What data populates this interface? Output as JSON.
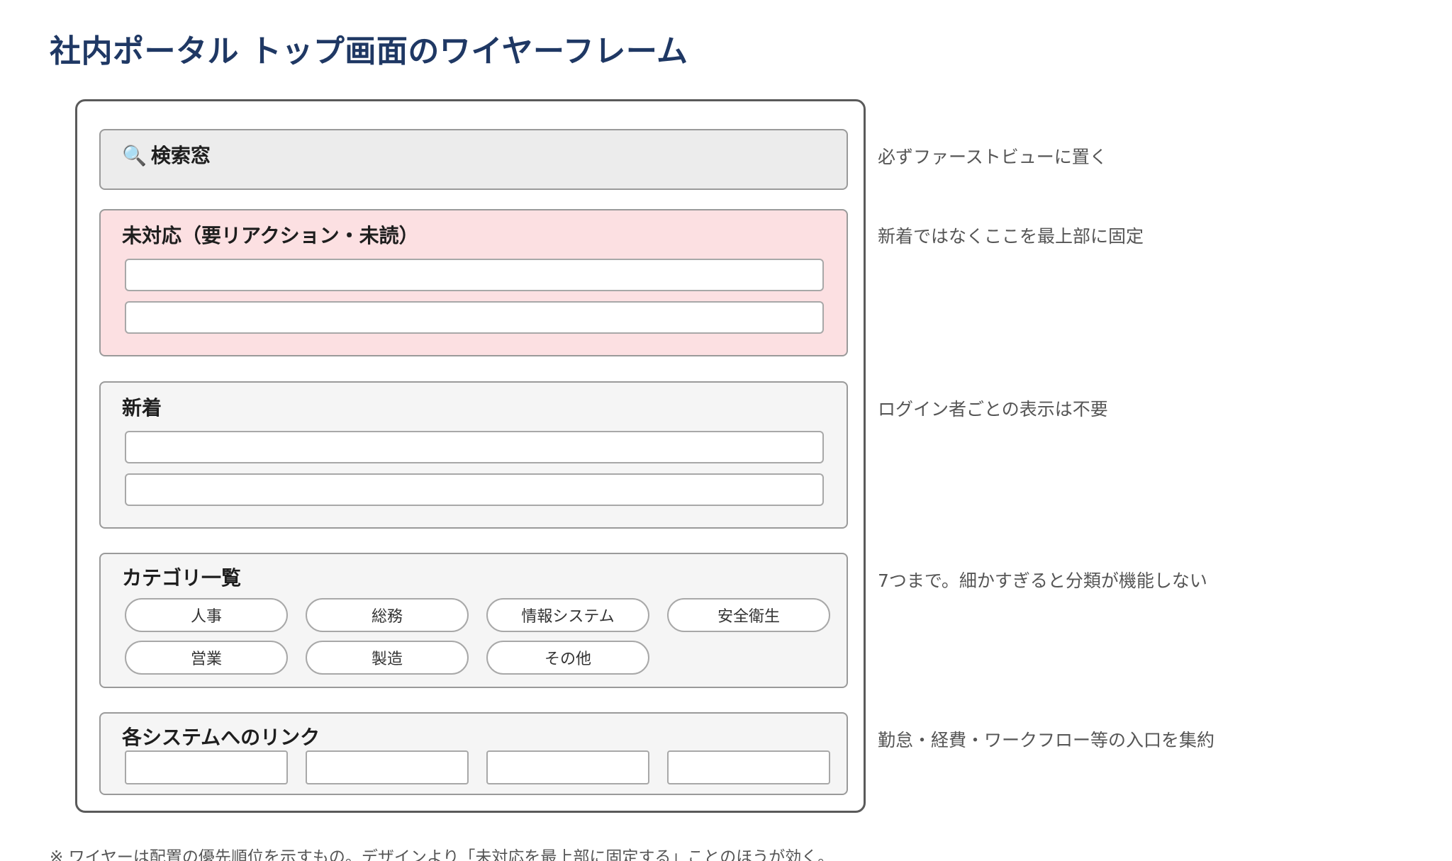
{
  "title": "社内ポータル トップ画面のワイヤーフレーム",
  "search": {
    "icon": "🔍",
    "label": "検索窓"
  },
  "unread": {
    "label": "未対応（要リアクション・未読）"
  },
  "new": {
    "label": "新着"
  },
  "categories": {
    "label": "カテゴリ一覧",
    "items": [
      "人事",
      "総務",
      "情報システム",
      "安全衛生",
      "営業",
      "製造",
      "その他"
    ]
  },
  "links": {
    "label": "各システムへのリンク"
  },
  "notes": [
    "必ずファーストビューに置く",
    "新着ではなくここを最上部に固定",
    "ログイン者ごとの表示は不要",
    "7つまで。細かすぎると分類が機能しない",
    "勤怠・経費・ワークフロー等の入口を集約"
  ],
  "footnote": "※ ワイヤーは配置の優先順位を示すもの。デザインより「未対応を最上部に固定する」ことのほうが効く。",
  "colors": {
    "title": "#1f3864",
    "unread_bg": "#fce0e2",
    "box_bg": "#f5f5f5",
    "search_bg": "#ececec"
  }
}
